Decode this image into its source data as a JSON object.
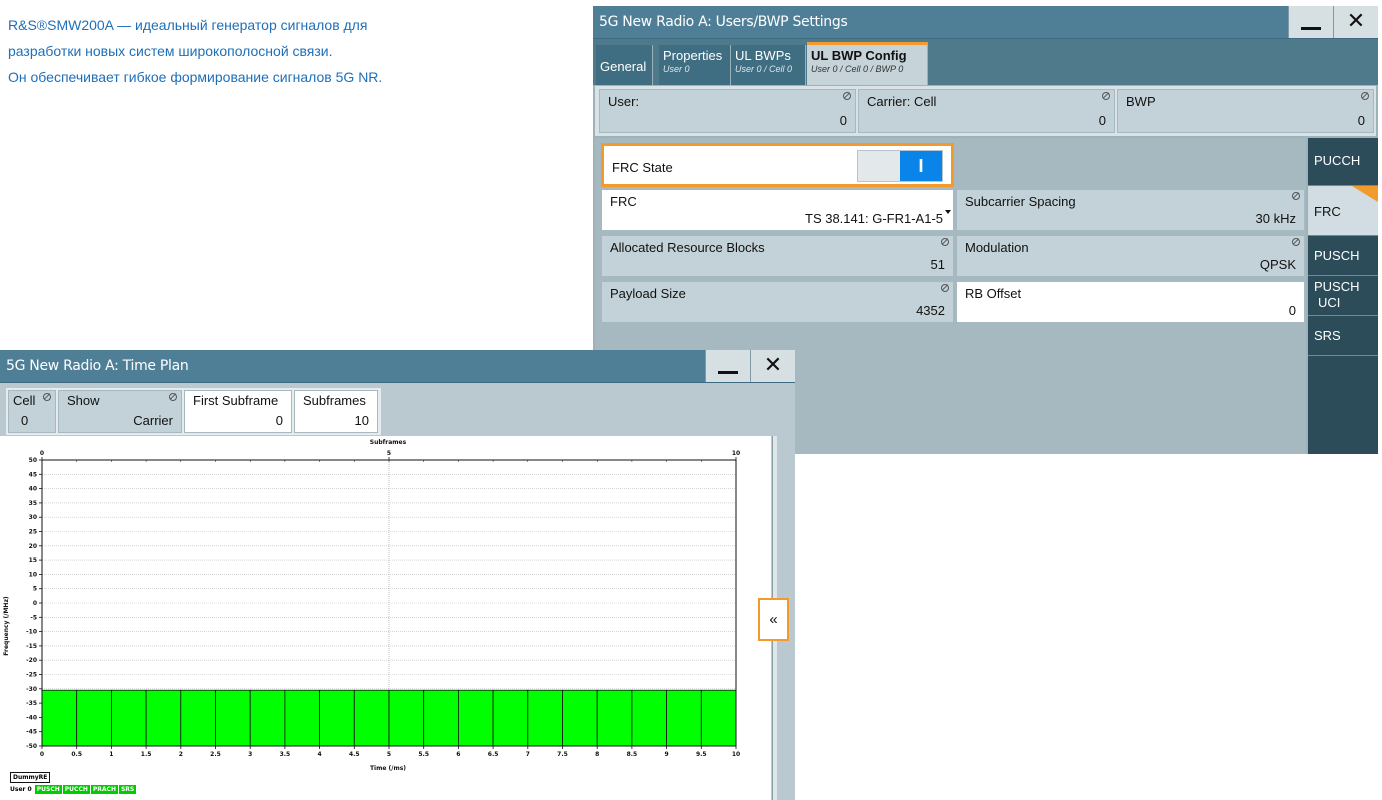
{
  "caption": {
    "line1": "R&S®SMW200A — идеальный генератор сигналов для",
    "line2": "разработки новых систем широкополосной связи.",
    "line3": "Он обеспечивает гибкое формирование сигналов 5G NR."
  },
  "bwp": {
    "title": "5G New Radio A: Users/BWP Settings",
    "tabs": [
      {
        "label": "General",
        "sub": ""
      },
      {
        "label": "Properties",
        "sub": "User 0"
      },
      {
        "label": "UL BWPs",
        "sub": "User 0 / Cell 0"
      },
      {
        "label": "UL BWP Config",
        "sub": "User 0 / Cell 0 / BWP 0"
      }
    ],
    "header_fields": [
      {
        "label": "User:",
        "value": "0"
      },
      {
        "label": "Carrier: Cell",
        "value": "0"
      },
      {
        "label": "BWP",
        "value": "0"
      }
    ],
    "frc_state": {
      "label": "FRC State",
      "toggle": "I"
    },
    "frc": {
      "label": "FRC",
      "value": "TS 38.141: G-FR1-A1-5"
    },
    "subcarrier_spacing": {
      "label": "Subcarrier Spacing",
      "value": "30 kHz"
    },
    "allocated_rb": {
      "label": "Allocated Resource Blocks",
      "value": "51"
    },
    "modulation": {
      "label": "Modulation",
      "value": "QPSK"
    },
    "payload_size": {
      "label": "Payload Size",
      "value": "4352"
    },
    "rb_offset": {
      "label": "RB Offset",
      "value": "0"
    },
    "side_tabs": [
      "PUCCH",
      "FRC",
      "PUSCH",
      "PUSCH",
      "UCI",
      "SRS"
    ]
  },
  "timeplan": {
    "title": "5G New Radio A: Time Plan",
    "cell": {
      "label": "Cell",
      "value": "0"
    },
    "show": {
      "label": "Show",
      "value": "Carrier"
    },
    "first_subframe": {
      "label": "First Subframe",
      "value": "0"
    },
    "subframes": {
      "label": "Subframes",
      "value": "10"
    },
    "collapse_button": "«",
    "legend": {
      "box": "DummyRE",
      "user": "User 0",
      "items": [
        "PUSCH",
        "PUCCH",
        "PRACH",
        "SRS"
      ]
    }
  },
  "chart_data": {
    "type": "heatmap",
    "title": "",
    "top_axis_label": "Subframes",
    "top_ticks": [
      "0",
      "5",
      "10"
    ],
    "xlabel": "Time (/ms)",
    "ylabel": "Frequency (/MHz)",
    "xlim": [
      0,
      10
    ],
    "ylim": [
      -50,
      50
    ],
    "x_ticks": [
      "0",
      "0.5",
      "1",
      "1.5",
      "2",
      "2.5",
      "3",
      "3.5",
      "4",
      "4.5",
      "5",
      "5.5",
      "6",
      "6.5",
      "7",
      "7.5",
      "8",
      "8.5",
      "9",
      "9.5",
      "10"
    ],
    "y_ticks": [
      "50",
      "45",
      "40",
      "35",
      "30",
      "25",
      "20",
      "15",
      "10",
      "5",
      "0",
      "-5",
      "-10",
      "-15",
      "-20",
      "-25",
      "-30",
      "-35",
      "-40",
      "-45",
      "-50"
    ],
    "grid": true,
    "blocks": {
      "y_from": -50,
      "y_to": -30.5,
      "x_from": 0,
      "x_to": 10,
      "slot_ms": 0.5,
      "color": "#00ff00"
    }
  }
}
